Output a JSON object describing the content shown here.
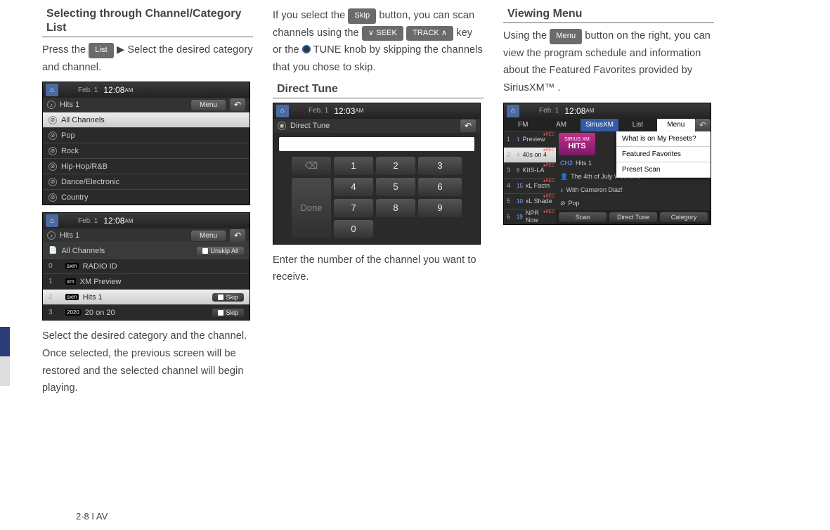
{
  "footer": "2-8 I AV",
  "col1": {
    "heading": "Selecting through Channel/Category List",
    "para1a": "Press the ",
    "btn_list": "List",
    "para1b": " ▶ Select the desired category and channel.",
    "para2": "Select the desired category and the channel. Once selected, the previous screen will be restored and the selected channel will begin playing.",
    "screenA": {
      "date": "Feb.  1",
      "time": "12:08",
      "ampm": "AM",
      "subtitle": "Hits 1",
      "menu": "Menu",
      "rows": [
        "All Channels",
        "Pop",
        "Rock",
        "Hip-Hop/R&B",
        "Dance/Electronic",
        "Country"
      ]
    },
    "screenB": {
      "date": "Feb.  1",
      "time": "12:08",
      "ampm": "AM",
      "subtitle": "Hits 1",
      "menu": "Menu",
      "head": "All Channels",
      "unskip": "Unskip All",
      "rows": [
        {
          "n": "0",
          "logo": "sxm",
          "label": "RADIO ID",
          "skip": false
        },
        {
          "n": "1",
          "logo": "xm",
          "label": "XM Preview",
          "skip": false
        },
        {
          "n": "2",
          "logo": "sxm",
          "label": "Hits 1",
          "skip": true,
          "sel": true
        },
        {
          "n": "3",
          "logo": "2020",
          "label": "20 on 20",
          "skip": true
        }
      ],
      "skip_label": "Skip"
    }
  },
  "col2": {
    "para1a": "If you select the ",
    "btn_skip": "Skip",
    "para1b": " button, you can scan channels using the ",
    "btn_seek": "∨ SEEK",
    "btn_track": "TRACK ∧",
    "para1c": " key or the ",
    "tune": " TUNE",
    "para1d": " knob by skipping the channels that you chose to skip.",
    "heading": "Direct Tune",
    "screen": {
      "date": "Feb.  1",
      "time": "12:03",
      "ampm": "AM",
      "title": "Direct Tune",
      "keys": [
        "1",
        "2",
        "3",
        "4",
        "5",
        "6",
        "7",
        "8",
        "9",
        "0"
      ],
      "del": "⌫",
      "done": "Done"
    },
    "para2": "Enter the number of the channel you want to receive."
  },
  "col3": {
    "heading": "Viewing Menu",
    "para1a": "Using the ",
    "btn_menu": "Menu",
    "para1b": " button on the right, you can view the program schedule and information about the Featured Favorites provided by SiriusXM™ .",
    "screen": {
      "date": "Feb.  1",
      "time": "12:08",
      "ampm": "AM",
      "tabs": [
        "FM",
        "AM",
        "SiriusXM",
        "List",
        "Menu"
      ],
      "presets": [
        {
          "p": "1",
          "c": "1",
          "name": "Preview"
        },
        {
          "p": "2",
          "c": "4",
          "name": "40s on 4",
          "sel": true
        },
        {
          "p": "3",
          "c": "6",
          "name": "KIIS-LA"
        },
        {
          "p": "4",
          "c": "15",
          "name": "xL Factn"
        },
        {
          "p": "5",
          "c": "10",
          "name": "xL Shade"
        },
        {
          "p": "6",
          "c": "19",
          "name": "NPR Now"
        }
      ],
      "popup": [
        "What is on My Presets?",
        "Featured Favorites",
        "Preset Scan"
      ],
      "logo_top": "SIRIUS XM",
      "logo_bot": "HITS",
      "now": [
        {
          "ch": "CH2",
          "txt": "Hits 1"
        },
        {
          "ico": "👤",
          "txt": "The 4th of July Weekend"
        },
        {
          "ico": "♪",
          "txt": "With Cameron Diaz!"
        },
        {
          "ico": "⊘",
          "txt": "Pop"
        }
      ],
      "bottom": [
        "Scan",
        "Direct Tune",
        "Category"
      ]
    }
  }
}
